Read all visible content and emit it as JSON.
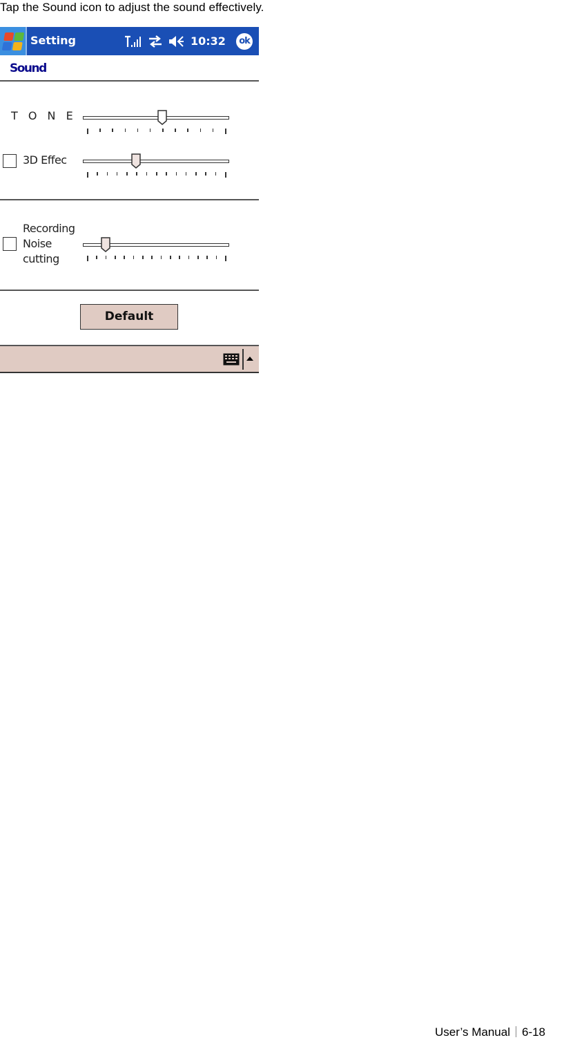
{
  "caption": "Tap the Sound icon to adjust the sound effectively.",
  "device": {
    "titlebar": {
      "start_icon": "windows-flag-icon",
      "app_title": "Setting",
      "status_icons": [
        "signal-strength-icon",
        "sync-arrows-icon",
        "speaker-volume-icon"
      ],
      "clock": "10:32",
      "ok_label": "ok",
      "colors": {
        "titlebar": "#1a4fb5",
        "start_button": "#3b8fe0"
      }
    },
    "page_title": "Sound",
    "controls": {
      "tone": {
        "label": "T O N E",
        "tick_count": 12,
        "value_index": 6
      },
      "effect_3d": {
        "label": "3D Effec",
        "checked": false,
        "tick_count": 15,
        "value_index": 5
      },
      "recording_noise": {
        "label_lines": [
          "Recording",
          "Noise",
          "cutting"
        ],
        "checked": false,
        "tick_count": 16,
        "value_index": 2
      }
    },
    "default_button": "Default",
    "menubar": {
      "keyboard_icon": "keyboard-icon",
      "sip_arrow_icon": "arrow-up-icon",
      "color": "#e0cbc3"
    }
  },
  "footer": {
    "manual": "User’s Manual",
    "page": "6-18"
  }
}
